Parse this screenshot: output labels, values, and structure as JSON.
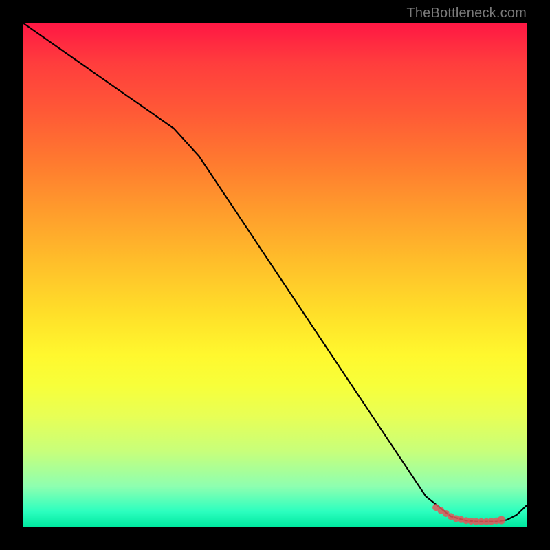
{
  "watermark": "TheBottleneck.com",
  "colors": {
    "frame": "#000000",
    "line": "#000000",
    "marker": "#e15759",
    "gradient_top": "#ff1744",
    "gradient_bottom": "#00e8a0"
  },
  "chart_data": {
    "type": "line",
    "title": "",
    "xlabel": "",
    "ylabel": "",
    "xlim": [
      0,
      100
    ],
    "ylim": [
      0,
      100
    ],
    "grid": false,
    "legend": false,
    "series": [
      {
        "name": "curve",
        "x": [
          0,
          5,
          10,
          15,
          20,
          25,
          30,
          35,
          40,
          45,
          50,
          55,
          60,
          65,
          70,
          75,
          80,
          85,
          88,
          90,
          92,
          94,
          96,
          98,
          100
        ],
        "y": [
          100,
          96.5,
          93,
          89.5,
          86,
          82.5,
          79,
          73.5,
          66,
          58.5,
          51,
          43.5,
          36,
          28.5,
          21,
          13.5,
          6,
          2,
          1.2,
          1,
          1,
          1,
          1.3,
          2.3,
          4.2
        ]
      }
    ],
    "markers": {
      "name": "highlight",
      "x": [
        82,
        83,
        84,
        85,
        86,
        87,
        88,
        89,
        90,
        91,
        92,
        93,
        94,
        95
      ],
      "y": [
        3.8,
        3.2,
        2.6,
        2.0,
        1.6,
        1.4,
        1.2,
        1.1,
        1.0,
        1.0,
        1.0,
        1.05,
        1.15,
        1.3
      ]
    }
  }
}
